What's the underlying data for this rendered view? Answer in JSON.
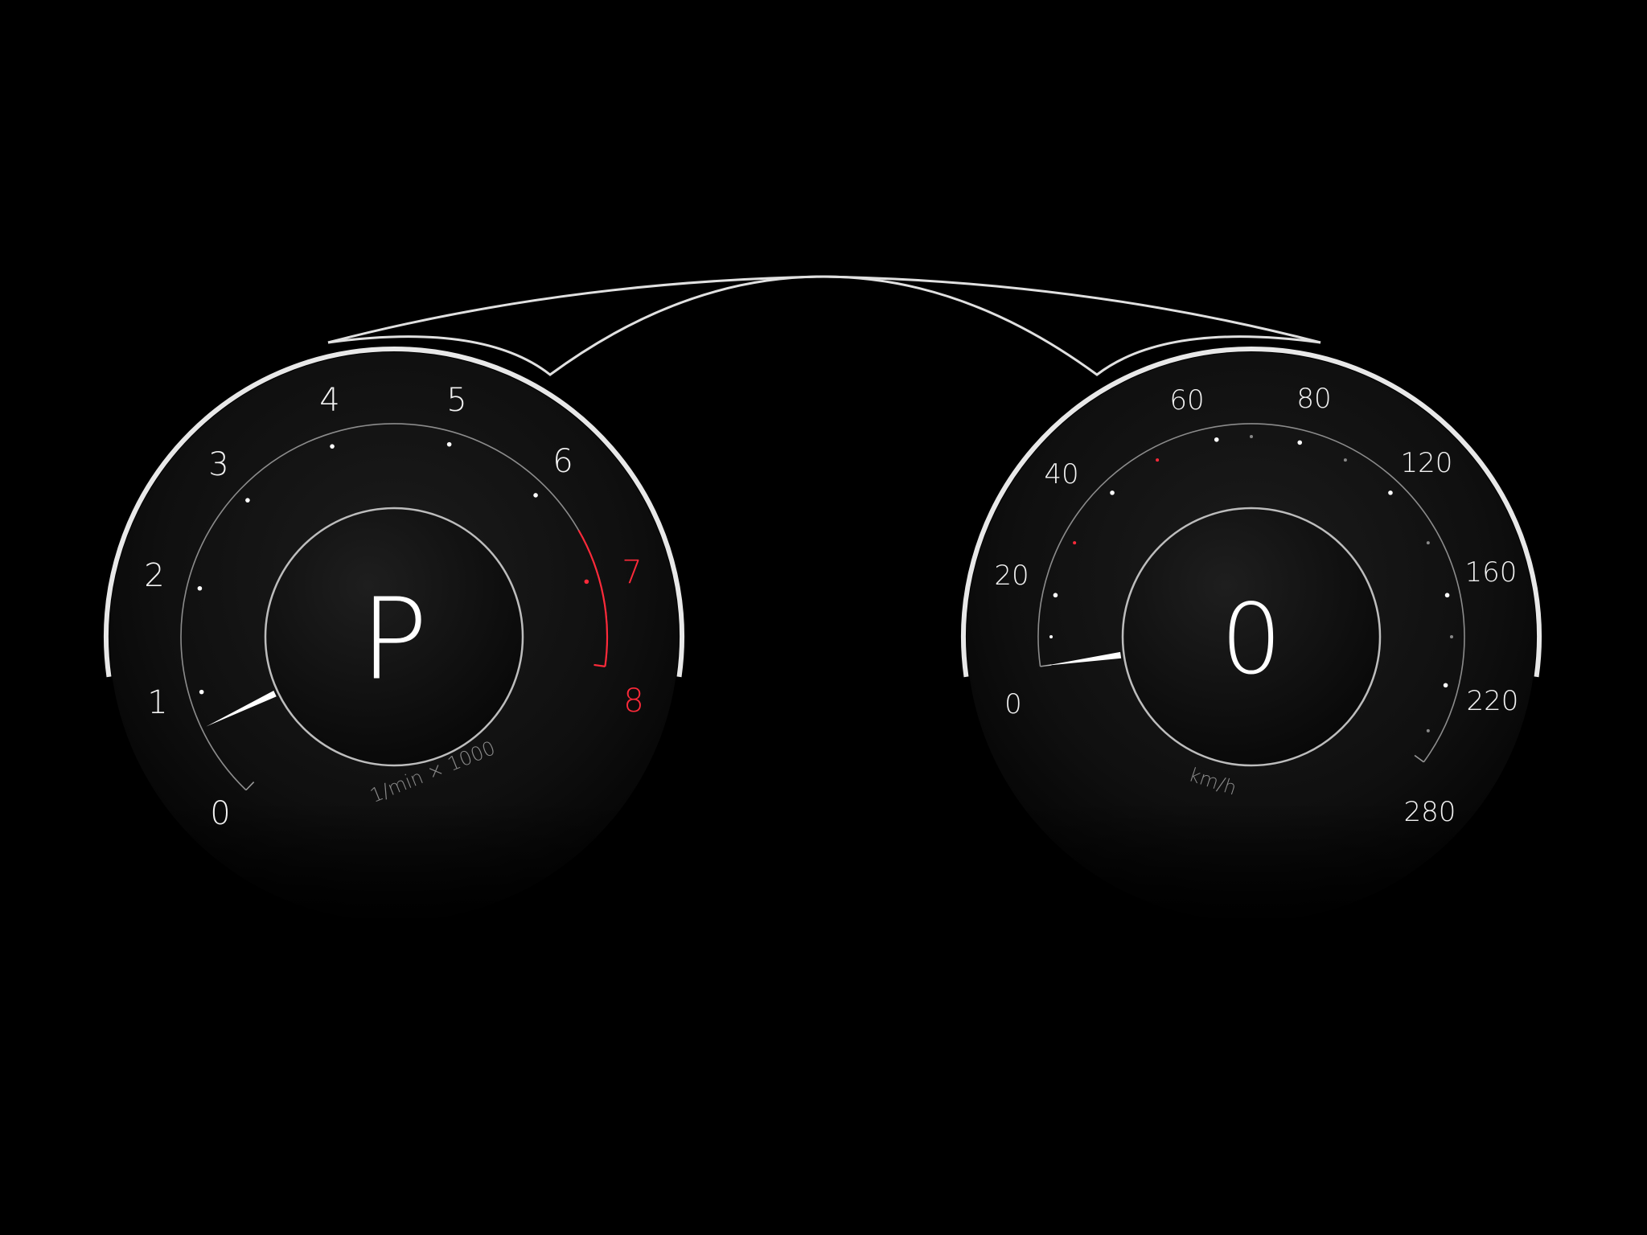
{
  "cluster": {
    "background": "#000000",
    "bezel_color": "#e6e6e6",
    "accent_red": "#ff2a3a"
  },
  "tachometer": {
    "gear": "P",
    "unit": "1/min × 1000",
    "value": 0.7,
    "redline_start": 6.5,
    "ticks": [
      "0",
      "1",
      "2",
      "3",
      "4",
      "5",
      "6",
      "7",
      "8"
    ],
    "red_ticks": [
      "7",
      "8"
    ]
  },
  "speedometer": {
    "speed": "0",
    "unit": "km/h",
    "value": 0,
    "ticks": [
      "0",
      "20",
      "40",
      "60",
      "80",
      "120",
      "160",
      "220",
      "280"
    ]
  }
}
